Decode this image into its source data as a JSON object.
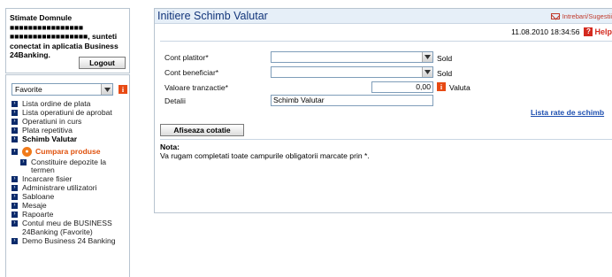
{
  "user": {
    "greeting": "Stimate Domnule ■■■■■■■■■■■■■■■■ ■■■■■■■■■■■■■■■■■, sunteti conectat in aplicatia Business 24Banking.",
    "logout_label": "Logout"
  },
  "favorites": {
    "selected": "Favorite",
    "info_icon": "i"
  },
  "nav": {
    "items": [
      "Lista ordine de plata",
      "Lista operatiuni de aprobat",
      "Operatiuni in curs",
      "Plata repetitiva",
      "Schimb Valutar",
      "Cumpara produse",
      "Constituire depozite la termen",
      "Incarcare fisier",
      "Administrare utilizatori",
      "Sabloane",
      "Mesaje",
      "Rapoarte",
      "Contul meu de BUSINESS 24Banking (Favorite)",
      "Demo Business 24 Banking"
    ]
  },
  "main": {
    "title": "Initiere Schimb Valutar",
    "feedback_label": "Intrebari/Sugestii",
    "datetime": "11.08.2010 18:34:56",
    "help_label": "Help",
    "help_icon": "?",
    "accent_color": "#12357a"
  },
  "form": {
    "payer_label": "Cont platitor*",
    "payer_value": "",
    "payer_side": "Sold",
    "beneficiary_label": "Cont beneficiar*",
    "beneficiary_value": "",
    "beneficiary_side": "Sold",
    "amount_label": "Valoare tranzactie*",
    "amount_value": "0,00",
    "currency_label": "Valuta",
    "details_label": "Detalii",
    "details_value": "Schimb Valutar",
    "rates_link": "Lista rate de schimb",
    "quote_button": "Afiseaza cotatie",
    "note_title": "Nota:",
    "note_text": "Va rugam completati toate campurile obligatorii marcate prin *."
  }
}
